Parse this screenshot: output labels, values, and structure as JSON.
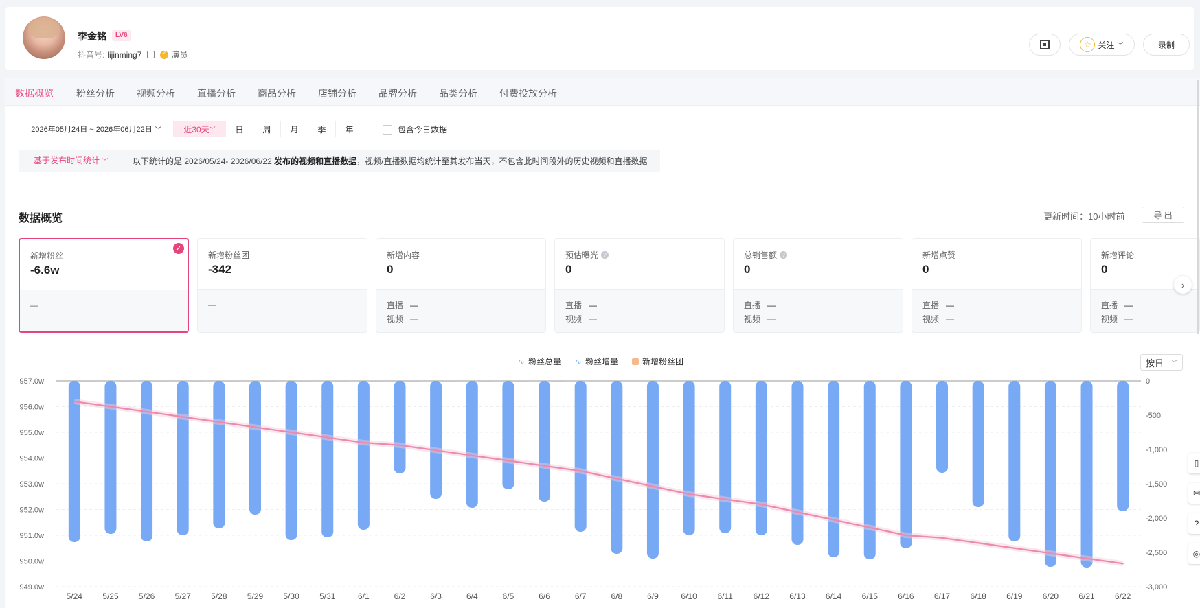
{
  "profile": {
    "name": "李金铭",
    "level": "LV6",
    "douyin_label": "抖音号:",
    "douyin_id": "lijinming7",
    "role": "演员",
    "follow_label": "关注",
    "record_label": "录制"
  },
  "tabs": [
    "数据概览",
    "粉丝分析",
    "视频分析",
    "直播分析",
    "商品分析",
    "店铺分析",
    "品牌分析",
    "品类分析",
    "付费投放分析"
  ],
  "filters": {
    "date_range": "2026年05月24日 ~ 2026年06月22日",
    "quick_range": "近30天",
    "periods": [
      "日",
      "周",
      "月",
      "季",
      "年"
    ],
    "include_today": "包含今日数据"
  },
  "notice": {
    "basis": "基于发布时间统计",
    "prefix": "以下统计的是 2026/05/24- 2026/06/22",
    "bold": "发布的视频和直播数据",
    "suffix": "，视频/直播数据均统计至其发布当天，不包含此时间段外的历史视频和直播数据"
  },
  "overview": {
    "title": "数据概览",
    "update_time": "更新时间：10小时前",
    "export_label": "导 出"
  },
  "metrics": [
    {
      "label": "新增粉丝",
      "value": "-6.6w",
      "rows": [],
      "dash": "—",
      "selected": true
    },
    {
      "label": "新增粉丝团",
      "value": "-342",
      "rows": [],
      "dash": "—"
    },
    {
      "label": "新增内容",
      "value": "0",
      "rows": [
        {
          "name": "直播",
          "val": "—"
        },
        {
          "name": "视频",
          "val": "—"
        }
      ]
    },
    {
      "label": "预估曝光",
      "value": "0",
      "help": true,
      "rows": [
        {
          "name": "直播",
          "val": "—"
        },
        {
          "name": "视频",
          "val": "—"
        }
      ]
    },
    {
      "label": "总销售额",
      "value": "0",
      "help": true,
      "rows": [
        {
          "name": "直播",
          "val": "—"
        },
        {
          "name": "视频",
          "val": "—"
        }
      ]
    },
    {
      "label": "新增点赞",
      "value": "0",
      "rows": [
        {
          "name": "直播",
          "val": "—"
        },
        {
          "name": "视频",
          "val": "—"
        }
      ]
    },
    {
      "label": "新增评论",
      "value": "0",
      "rows": [
        {
          "name": "直播",
          "val": "—"
        },
        {
          "name": "视频",
          "val": "—"
        }
      ]
    }
  ],
  "chart_select": "按日",
  "colors": {
    "accent": "#e8437a",
    "bar": "#78a9f5",
    "line": "#ec8aae",
    "fan_group": "#f5b98c"
  },
  "chart_data": {
    "type": "bar",
    "categories": [
      "5/24",
      "5/25",
      "5/26",
      "5/27",
      "5/28",
      "5/29",
      "5/30",
      "5/31",
      "6/1",
      "6/2",
      "6/3",
      "6/4",
      "6/5",
      "6/6",
      "6/7",
      "6/8",
      "6/9",
      "6/10",
      "6/11",
      "6/12",
      "6/13",
      "6/14",
      "6/15",
      "6/16",
      "6/17",
      "6/18",
      "6/19",
      "6/20",
      "6/21",
      "6/22"
    ],
    "legend": [
      "粉丝总量",
      "粉丝增量",
      "新增粉丝团"
    ],
    "y_left": {
      "min": 949.0,
      "max": 957.0,
      "ticks": [
        "957.0w",
        "956.0w",
        "955.0w",
        "954.0w",
        "953.0w",
        "952.0w",
        "951.0w",
        "950.0w",
        "949.0w"
      ]
    },
    "y_right": {
      "min": -3000,
      "max": 0,
      "ticks": [
        "0",
        "-500",
        "-1,000",
        "-1,500",
        "-2,000",
        "-2,500",
        "-3,000"
      ]
    },
    "series": [
      {
        "name": "粉丝增量",
        "axis": "right",
        "type": "bar",
        "values": [
          -2350,
          -2230,
          -2340,
          -2250,
          -2150,
          -1950,
          -2320,
          -2280,
          -2170,
          -1350,
          -1720,
          -1850,
          -1580,
          -1760,
          -2200,
          -2520,
          -2590,
          -2250,
          -2220,
          -2250,
          -2390,
          -2570,
          -2600,
          -2440,
          -1340,
          -1840,
          -2340,
          -2710,
          -2720,
          -1900
        ]
      },
      {
        "name": "粉丝总量",
        "axis": "left",
        "type": "line",
        "values": [
          956.2,
          956.0,
          955.8,
          955.6,
          955.4,
          955.2,
          955.0,
          954.8,
          954.6,
          954.5,
          954.3,
          954.1,
          953.9,
          953.7,
          953.5,
          953.2,
          952.9,
          952.6,
          952.4,
          952.2,
          951.9,
          951.6,
          951.3,
          951.0,
          950.9,
          950.7,
          950.5,
          950.3,
          950.1,
          949.9
        ]
      },
      {
        "name": "新增粉丝团",
        "axis": "right",
        "type": "bar",
        "values": [
          -12,
          -10,
          -13,
          -11,
          -12,
          -14,
          -11,
          -12,
          -10,
          -13,
          -12,
          -11,
          -12,
          -10,
          0,
          0,
          0,
          0,
          0,
          0,
          0,
          0,
          0,
          0,
          0,
          0,
          0,
          0,
          0,
          0
        ]
      }
    ]
  }
}
